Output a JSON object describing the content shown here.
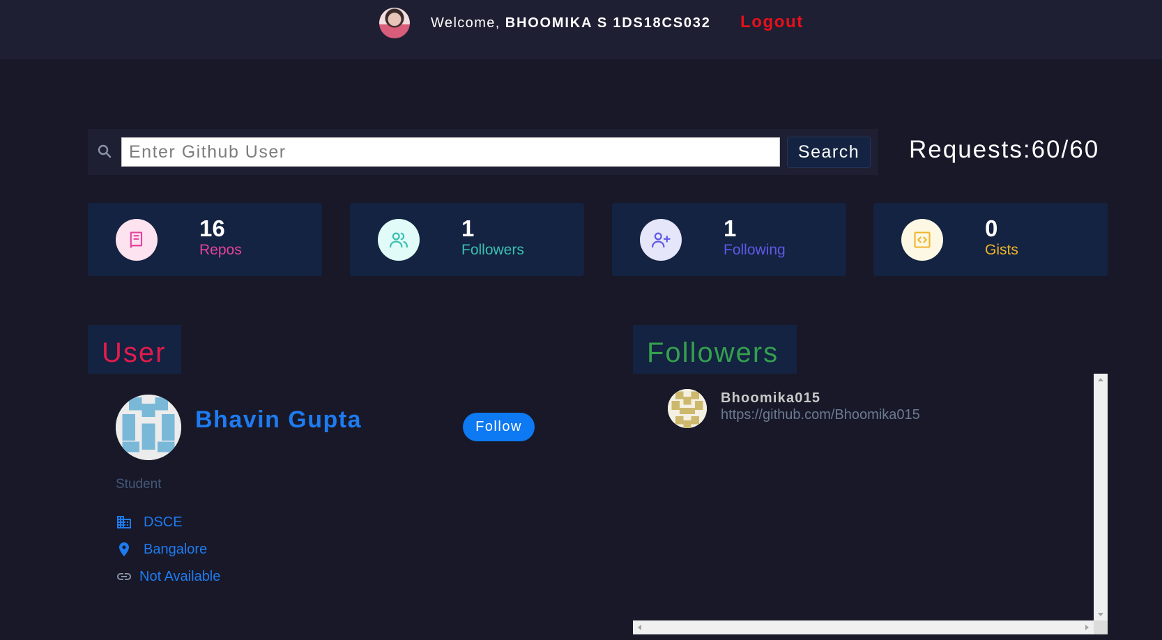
{
  "navbar": {
    "welcome_prefix": "Welcome,",
    "user_label": "BHOOMIKA S 1DS18CS032",
    "logout_label": "Logout"
  },
  "search": {
    "placeholder": "Enter Github User",
    "value": "",
    "button_label": "Search",
    "requests": "Requests:60/60"
  },
  "stats": [
    {
      "count": "16",
      "label": "Repos",
      "icon": "book-icon",
      "color": "#e5439c",
      "bg": "#fde2ef"
    },
    {
      "count": "1",
      "label": "Followers",
      "icon": "users-icon",
      "color": "#3bbfb0",
      "bg": "#e0fbf8"
    },
    {
      "count": "1",
      "label": "Following",
      "icon": "user-plus-icon",
      "color": "#6158e8",
      "bg": "#e6e6fb"
    },
    {
      "count": "0",
      "label": "Gists",
      "icon": "code-icon",
      "color": "#f0b429",
      "bg": "#fdf8e4"
    }
  ],
  "user_section": {
    "title": "User",
    "title_color": "#e31b4c",
    "name": "Bhavin Gupta",
    "follow_label": "Follow",
    "bio": "Student",
    "company": "DSCE",
    "location": "Bangalore",
    "blog": "Not Available"
  },
  "followers_section": {
    "title": "Followers",
    "title_color": "#34a04e",
    "items": [
      {
        "login": "Bhoomika015",
        "url": "https://github.com/Bhoomika015"
      }
    ]
  }
}
